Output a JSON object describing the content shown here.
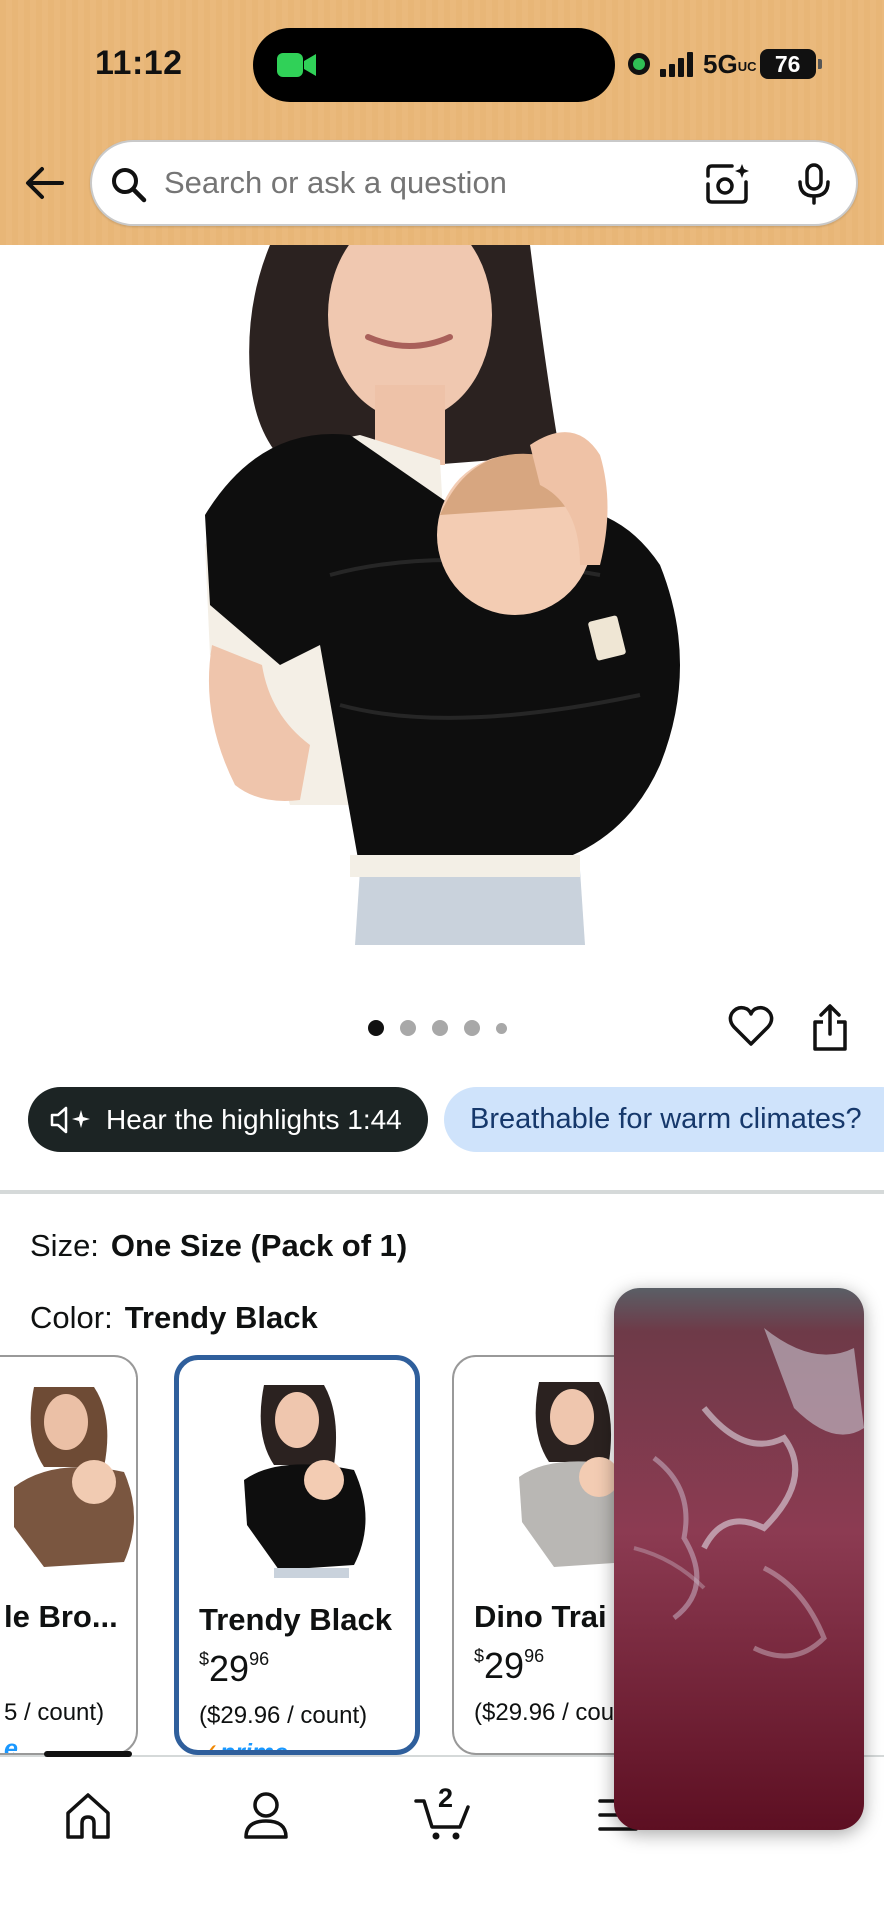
{
  "status_bar": {
    "time": "11:12",
    "network": "5G",
    "network_sub": "UC",
    "battery": "76"
  },
  "search": {
    "placeholder": "Search or ask a question"
  },
  "gallery": {
    "image_count": 5,
    "active_index": 0
  },
  "audio_chip": {
    "label": "Hear the highlights 1:44"
  },
  "ask_chip": {
    "label": "Breathable for warm climates?"
  },
  "size": {
    "label": "Size:",
    "value": "One Size (Pack of 1)"
  },
  "color": {
    "label": "Color:",
    "value": "Trendy Black"
  },
  "swatches": [
    {
      "name": "le Bro...",
      "price_whole": "",
      "price_cents": "",
      "unit": "5 / count)",
      "prime": "e",
      "selected": false
    },
    {
      "name": "Trendy Black",
      "price_whole": "29",
      "price_cents": "96",
      "currency": "$",
      "unit": "($29.96 / count)",
      "prime": "prime",
      "selected": true
    },
    {
      "name": "Dino Trai",
      "price_whole": "29",
      "price_cents": "96",
      "currency": "$",
      "unit": "($29.96 / cou",
      "prime": "",
      "selected": false
    }
  ],
  "cart": {
    "count": "2"
  },
  "colors": {
    "header_bg": "#e8b677",
    "chip_dark": "#1c2424",
    "chip_blue": "#cfe3fb",
    "selected_border": "#2f5f9c",
    "prime_blue": "#1a98ff"
  }
}
